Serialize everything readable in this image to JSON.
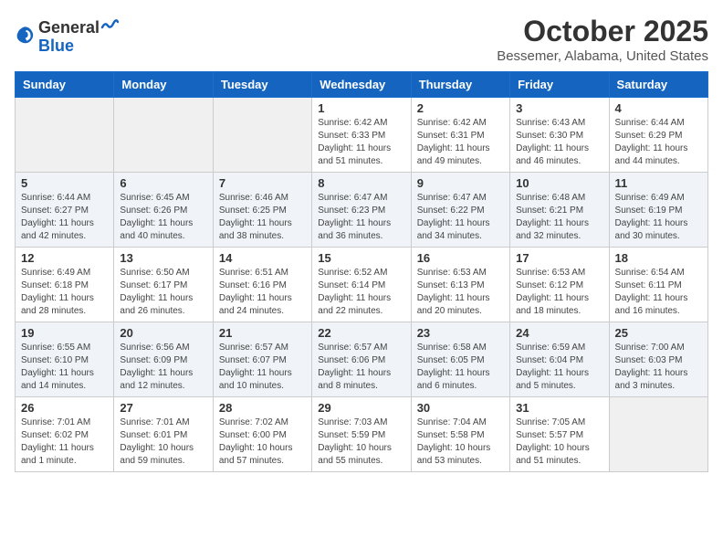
{
  "header": {
    "logo_general": "General",
    "logo_blue": "Blue",
    "month_title": "October 2025",
    "location": "Bessemer, Alabama, United States"
  },
  "days_of_week": [
    "Sunday",
    "Monday",
    "Tuesday",
    "Wednesday",
    "Thursday",
    "Friday",
    "Saturday"
  ],
  "weeks": [
    [
      {
        "day": "",
        "info": ""
      },
      {
        "day": "",
        "info": ""
      },
      {
        "day": "",
        "info": ""
      },
      {
        "day": "1",
        "info": "Sunrise: 6:42 AM\nSunset: 6:33 PM\nDaylight: 11 hours\nand 51 minutes."
      },
      {
        "day": "2",
        "info": "Sunrise: 6:42 AM\nSunset: 6:31 PM\nDaylight: 11 hours\nand 49 minutes."
      },
      {
        "day": "3",
        "info": "Sunrise: 6:43 AM\nSunset: 6:30 PM\nDaylight: 11 hours\nand 46 minutes."
      },
      {
        "day": "4",
        "info": "Sunrise: 6:44 AM\nSunset: 6:29 PM\nDaylight: 11 hours\nand 44 minutes."
      }
    ],
    [
      {
        "day": "5",
        "info": "Sunrise: 6:44 AM\nSunset: 6:27 PM\nDaylight: 11 hours\nand 42 minutes."
      },
      {
        "day": "6",
        "info": "Sunrise: 6:45 AM\nSunset: 6:26 PM\nDaylight: 11 hours\nand 40 minutes."
      },
      {
        "day": "7",
        "info": "Sunrise: 6:46 AM\nSunset: 6:25 PM\nDaylight: 11 hours\nand 38 minutes."
      },
      {
        "day": "8",
        "info": "Sunrise: 6:47 AM\nSunset: 6:23 PM\nDaylight: 11 hours\nand 36 minutes."
      },
      {
        "day": "9",
        "info": "Sunrise: 6:47 AM\nSunset: 6:22 PM\nDaylight: 11 hours\nand 34 minutes."
      },
      {
        "day": "10",
        "info": "Sunrise: 6:48 AM\nSunset: 6:21 PM\nDaylight: 11 hours\nand 32 minutes."
      },
      {
        "day": "11",
        "info": "Sunrise: 6:49 AM\nSunset: 6:19 PM\nDaylight: 11 hours\nand 30 minutes."
      }
    ],
    [
      {
        "day": "12",
        "info": "Sunrise: 6:49 AM\nSunset: 6:18 PM\nDaylight: 11 hours\nand 28 minutes."
      },
      {
        "day": "13",
        "info": "Sunrise: 6:50 AM\nSunset: 6:17 PM\nDaylight: 11 hours\nand 26 minutes."
      },
      {
        "day": "14",
        "info": "Sunrise: 6:51 AM\nSunset: 6:16 PM\nDaylight: 11 hours\nand 24 minutes."
      },
      {
        "day": "15",
        "info": "Sunrise: 6:52 AM\nSunset: 6:14 PM\nDaylight: 11 hours\nand 22 minutes."
      },
      {
        "day": "16",
        "info": "Sunrise: 6:53 AM\nSunset: 6:13 PM\nDaylight: 11 hours\nand 20 minutes."
      },
      {
        "day": "17",
        "info": "Sunrise: 6:53 AM\nSunset: 6:12 PM\nDaylight: 11 hours\nand 18 minutes."
      },
      {
        "day": "18",
        "info": "Sunrise: 6:54 AM\nSunset: 6:11 PM\nDaylight: 11 hours\nand 16 minutes."
      }
    ],
    [
      {
        "day": "19",
        "info": "Sunrise: 6:55 AM\nSunset: 6:10 PM\nDaylight: 11 hours\nand 14 minutes."
      },
      {
        "day": "20",
        "info": "Sunrise: 6:56 AM\nSunset: 6:09 PM\nDaylight: 11 hours\nand 12 minutes."
      },
      {
        "day": "21",
        "info": "Sunrise: 6:57 AM\nSunset: 6:07 PM\nDaylight: 11 hours\nand 10 minutes."
      },
      {
        "day": "22",
        "info": "Sunrise: 6:57 AM\nSunset: 6:06 PM\nDaylight: 11 hours\nand 8 minutes."
      },
      {
        "day": "23",
        "info": "Sunrise: 6:58 AM\nSunset: 6:05 PM\nDaylight: 11 hours\nand 6 minutes."
      },
      {
        "day": "24",
        "info": "Sunrise: 6:59 AM\nSunset: 6:04 PM\nDaylight: 11 hours\nand 5 minutes."
      },
      {
        "day": "25",
        "info": "Sunrise: 7:00 AM\nSunset: 6:03 PM\nDaylight: 11 hours\nand 3 minutes."
      }
    ],
    [
      {
        "day": "26",
        "info": "Sunrise: 7:01 AM\nSunset: 6:02 PM\nDaylight: 11 hours\nand 1 minute."
      },
      {
        "day": "27",
        "info": "Sunrise: 7:01 AM\nSunset: 6:01 PM\nDaylight: 10 hours\nand 59 minutes."
      },
      {
        "day": "28",
        "info": "Sunrise: 7:02 AM\nSunset: 6:00 PM\nDaylight: 10 hours\nand 57 minutes."
      },
      {
        "day": "29",
        "info": "Sunrise: 7:03 AM\nSunset: 5:59 PM\nDaylight: 10 hours\nand 55 minutes."
      },
      {
        "day": "30",
        "info": "Sunrise: 7:04 AM\nSunset: 5:58 PM\nDaylight: 10 hours\nand 53 minutes."
      },
      {
        "day": "31",
        "info": "Sunrise: 7:05 AM\nSunset: 5:57 PM\nDaylight: 10 hours\nand 51 minutes."
      },
      {
        "day": "",
        "info": ""
      }
    ]
  ]
}
